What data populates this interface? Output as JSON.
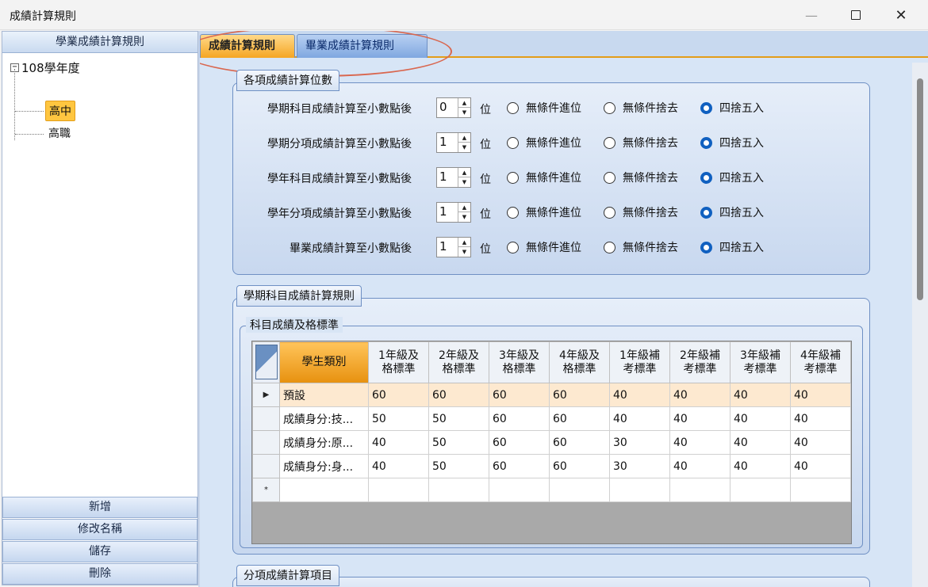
{
  "window": {
    "title": "成績計算規則",
    "minimize_glyph": "—",
    "maximize_glyph": "",
    "close_glyph": "✕"
  },
  "sidebar": {
    "header": "學業成績計算規則",
    "tree": {
      "expander": "−",
      "root": "108學年度",
      "children": [
        "高中",
        "高職"
      ],
      "selected": "高中"
    },
    "buttons": [
      "新增",
      "修改名稱",
      "儲存",
      "刪除"
    ]
  },
  "tabs": [
    {
      "label": "成績計算規則",
      "active": true
    },
    {
      "label": "畢業成績計算規則",
      "active": false
    }
  ],
  "decimal_group": {
    "title": "各項成績計算位數",
    "unit": "位",
    "options": [
      "無條件進位",
      "無條件捨去",
      "四捨五入"
    ],
    "rows": [
      {
        "label": "學期科目成績計算至小數點後",
        "value": "0",
        "selected": "四捨五入"
      },
      {
        "label": "學期分項成績計算至小數點後",
        "value": "1",
        "selected": "四捨五入"
      },
      {
        "label": "學年科目成績計算至小數點後",
        "value": "1",
        "selected": "四捨五入"
      },
      {
        "label": "學年分項成績計算至小數點後",
        "value": "1",
        "selected": "四捨五入"
      },
      {
        "label": "畢業成績計算至小數點後",
        "value": "1",
        "selected": "四捨五入"
      }
    ]
  },
  "semester_group": {
    "title": "學期科目成績計算規則",
    "subgroup_title": "科目成績及格標準",
    "grid": {
      "kind_header": "學生類別",
      "columns": [
        [
          "1年級及",
          "格標準"
        ],
        [
          "2年級及",
          "格標準"
        ],
        [
          "3年級及",
          "格標準"
        ],
        [
          "4年級及",
          "格標準"
        ],
        [
          "1年級補",
          "考標準"
        ],
        [
          "2年級補",
          "考標準"
        ],
        [
          "3年級補",
          "考標準"
        ],
        [
          "4年級補",
          "考標準"
        ]
      ],
      "current_marker": "▶",
      "new_row_marker": "*",
      "rows": [
        {
          "kind": "預設",
          "values": [
            "60",
            "60",
            "60",
            "60",
            "40",
            "40",
            "40",
            "40"
          ]
        },
        {
          "kind": "成績身分:技...",
          "values": [
            "50",
            "50",
            "60",
            "60",
            "40",
            "40",
            "40",
            "40"
          ]
        },
        {
          "kind": "成績身分:原...",
          "values": [
            "40",
            "50",
            "60",
            "60",
            "30",
            "40",
            "40",
            "40"
          ]
        },
        {
          "kind": "成績身分:身...",
          "values": [
            "40",
            "50",
            "60",
            "60",
            "30",
            "40",
            "40",
            "40"
          ]
        }
      ]
    }
  },
  "category_group": {
    "title": "分項成績計算項目"
  }
}
